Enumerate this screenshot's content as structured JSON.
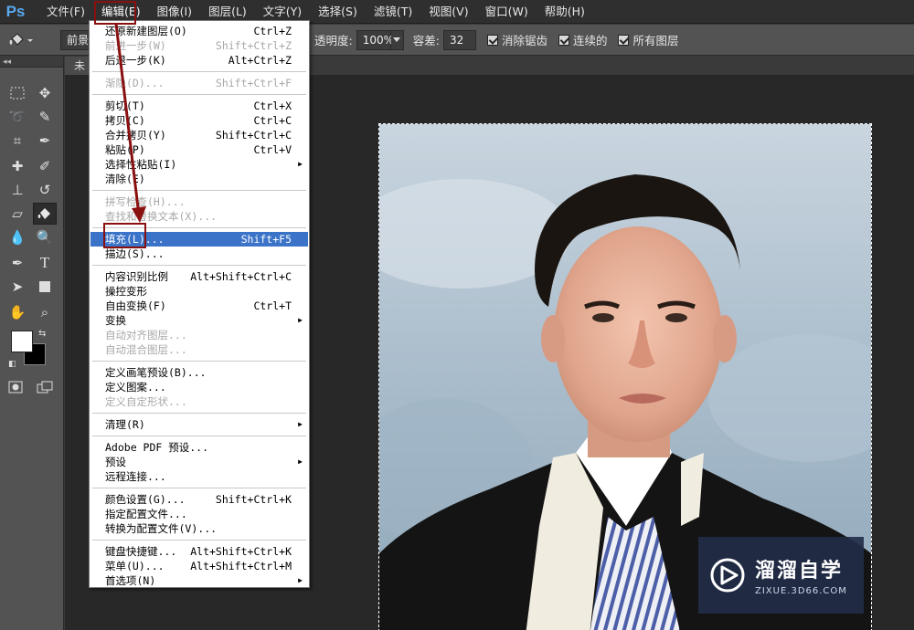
{
  "app": {
    "logo": "Ps"
  },
  "menubar": {
    "items": [
      {
        "label": "文件(F)",
        "active": false
      },
      {
        "label": "编辑(E)",
        "active": true
      },
      {
        "label": "图像(I)",
        "active": false
      },
      {
        "label": "图层(L)",
        "active": false
      },
      {
        "label": "文字(Y)",
        "active": false
      },
      {
        "label": "选择(S)",
        "active": false
      },
      {
        "label": "滤镜(T)",
        "active": false
      },
      {
        "label": "视图(V)",
        "active": false
      },
      {
        "label": "窗口(W)",
        "active": false
      },
      {
        "label": "帮助(H)",
        "active": false
      }
    ]
  },
  "options": {
    "fill_source": "前景",
    "opacity_label": "透明度:",
    "opacity_value": "100%",
    "tolerance_label": "容差:",
    "tolerance_value": "32",
    "antialias_label": "消除锯齿",
    "contiguous_label": "连续的",
    "all_layers_label": "所有图层"
  },
  "document": {
    "tab_label": "未"
  },
  "edit_menu": {
    "items": [
      {
        "label": "还原新建图层(O)",
        "shortcut": "Ctrl+Z",
        "disabled": false,
        "submenu": false
      },
      {
        "label": "前进一步(W)",
        "shortcut": "Shift+Ctrl+Z",
        "disabled": true,
        "submenu": false
      },
      {
        "label": "后退一步(K)",
        "shortcut": "Alt+Ctrl+Z",
        "disabled": false,
        "submenu": false,
        "sep_after": true
      },
      {
        "label": "渐隐(D)...",
        "shortcut": "Shift+Ctrl+F",
        "disabled": true,
        "submenu": false,
        "sep_after": true
      },
      {
        "label": "剪切(T)",
        "shortcut": "Ctrl+X",
        "disabled": false,
        "submenu": false
      },
      {
        "label": "拷贝(C)",
        "shortcut": "Ctrl+C",
        "disabled": false,
        "submenu": false
      },
      {
        "label": "合并拷贝(Y)",
        "shortcut": "Shift+Ctrl+C",
        "disabled": false,
        "submenu": false
      },
      {
        "label": "粘贴(P)",
        "shortcut": "Ctrl+V",
        "disabled": false,
        "submenu": false
      },
      {
        "label": "选择性粘贴(I)",
        "shortcut": "",
        "disabled": false,
        "submenu": true
      },
      {
        "label": "清除(E)",
        "shortcut": "",
        "disabled": false,
        "submenu": false,
        "sep_after": true
      },
      {
        "label": "拼写检查(H)...",
        "shortcut": "",
        "disabled": true,
        "submenu": false
      },
      {
        "label": "查找和替换文本(X)...",
        "shortcut": "",
        "disabled": true,
        "submenu": false,
        "sep_after": true
      },
      {
        "label": "填充(L)...",
        "shortcut": "Shift+F5",
        "disabled": false,
        "submenu": false,
        "highlighted": true
      },
      {
        "label": "描边(S)...",
        "shortcut": "",
        "disabled": false,
        "submenu": false,
        "sep_after": true
      },
      {
        "label": "内容识别比例",
        "shortcut": "Alt+Shift+Ctrl+C",
        "disabled": false,
        "submenu": false
      },
      {
        "label": "操控变形",
        "shortcut": "",
        "disabled": false,
        "submenu": false
      },
      {
        "label": "自由变换(F)",
        "shortcut": "Ctrl+T",
        "disabled": false,
        "submenu": false
      },
      {
        "label": "变换",
        "shortcut": "",
        "disabled": false,
        "submenu": true
      },
      {
        "label": "自动对齐图层...",
        "shortcut": "",
        "disabled": true,
        "submenu": false
      },
      {
        "label": "自动混合图层...",
        "shortcut": "",
        "disabled": true,
        "submenu": false,
        "sep_after": true
      },
      {
        "label": "定义画笔预设(B)...",
        "shortcut": "",
        "disabled": false,
        "submenu": false
      },
      {
        "label": "定义图案...",
        "shortcut": "",
        "disabled": false,
        "submenu": false
      },
      {
        "label": "定义自定形状...",
        "shortcut": "",
        "disabled": true,
        "submenu": false,
        "sep_after": true
      },
      {
        "label": "清理(R)",
        "shortcut": "",
        "disabled": false,
        "submenu": true,
        "sep_after": true
      },
      {
        "label": "Adobe PDF 预设...",
        "shortcut": "",
        "disabled": false,
        "submenu": false
      },
      {
        "label": "预设",
        "shortcut": "",
        "disabled": false,
        "submenu": true
      },
      {
        "label": "远程连接...",
        "shortcut": "",
        "disabled": false,
        "submenu": false,
        "sep_after": true
      },
      {
        "label": "颜色设置(G)...",
        "shortcut": "Shift+Ctrl+K",
        "disabled": false,
        "submenu": false
      },
      {
        "label": "指定配置文件...",
        "shortcut": "",
        "disabled": false,
        "submenu": false
      },
      {
        "label": "转换为配置文件(V)...",
        "shortcut": "",
        "disabled": false,
        "submenu": false,
        "sep_after": true
      },
      {
        "label": "键盘快捷键...",
        "shortcut": "Alt+Shift+Ctrl+K",
        "disabled": false,
        "submenu": false
      },
      {
        "label": "菜单(U)...",
        "shortcut": "Alt+Shift+Ctrl+M",
        "disabled": false,
        "submenu": false
      },
      {
        "label": "首选项(N)",
        "shortcut": "",
        "disabled": false,
        "submenu": true
      }
    ]
  },
  "watermark": {
    "title": "溜溜自学",
    "url": "ZIXUE.3D66.COM"
  },
  "colors": {
    "menu_highlight": "#3a73c8",
    "annotation": "#8a1010",
    "foreground_swatch": "#ffffff",
    "background_swatch": "#000000"
  },
  "icons": {
    "paint_bucket": "paint-bucket-icon",
    "marquee": "marquee-icon",
    "move": "move-icon"
  }
}
